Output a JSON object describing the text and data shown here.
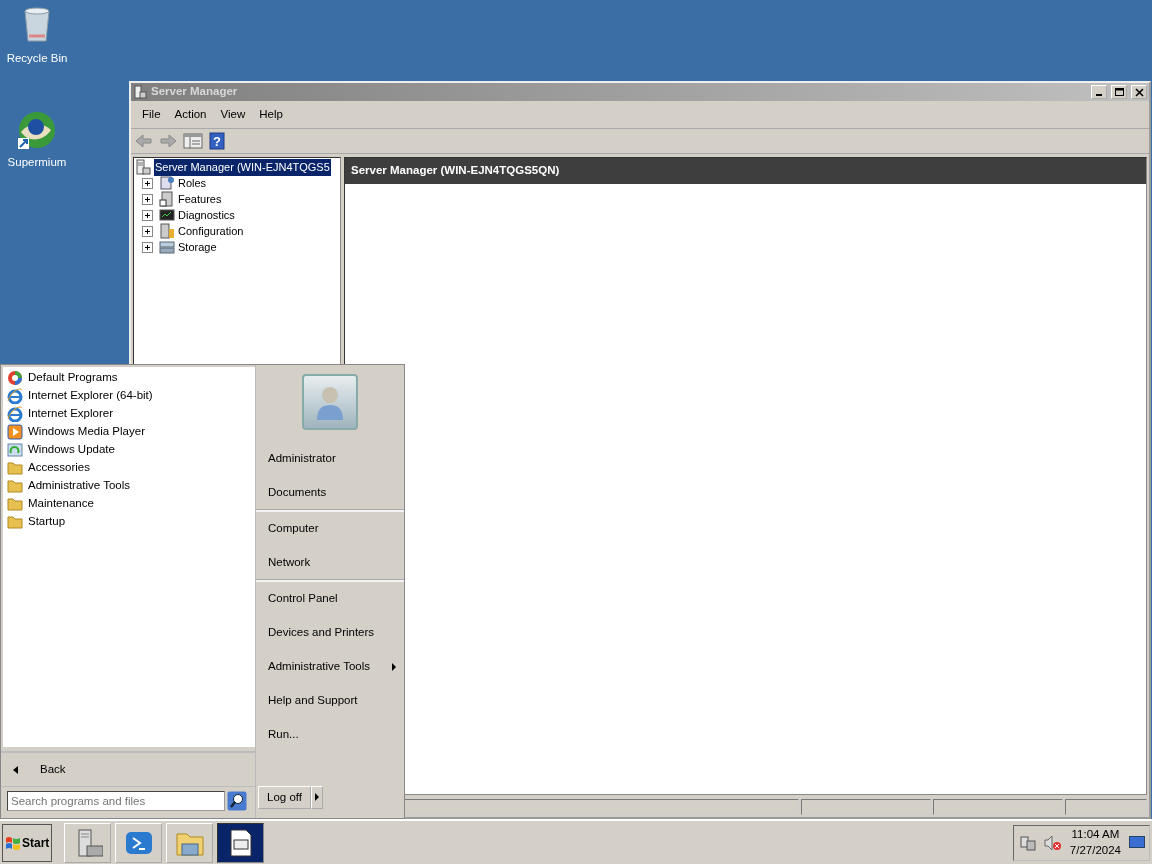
{
  "desktop_icons": [
    {
      "label": "Recycle Bin"
    },
    {
      "label": "Supermium"
    }
  ],
  "window": {
    "title": "Server Manager",
    "menu": [
      "File",
      "Action",
      "View",
      "Help"
    ],
    "help_glyph": "?",
    "tree": {
      "label": "Server Manager (WIN-EJN4TQGS5",
      "selected": true,
      "children": [
        {
          "label": "Roles",
          "expanded": false
        },
        {
          "label": "Features",
          "expanded": false
        },
        {
          "label": "Diagnostics",
          "expanded": false
        },
        {
          "label": "Configuration",
          "expanded": false
        },
        {
          "label": "Storage",
          "expanded": false
        }
      ]
    },
    "detail_header": "Server Manager (WIN-EJN4TQGS5QN)"
  },
  "start_menu": {
    "programs": [
      {
        "label": "Default Programs",
        "kind": "app"
      },
      {
        "label": "Internet Explorer (64-bit)",
        "kind": "app"
      },
      {
        "label": "Internet Explorer",
        "kind": "app"
      },
      {
        "label": "Windows Media Player",
        "kind": "app"
      },
      {
        "label": "Windows Update",
        "kind": "app"
      },
      {
        "label": "Accessories",
        "kind": "folder"
      },
      {
        "label": "Administrative Tools",
        "kind": "folder"
      },
      {
        "label": "Maintenance",
        "kind": "folder"
      },
      {
        "label": "Startup",
        "kind": "folder"
      }
    ],
    "back": "Back",
    "search": {
      "placeholder": "Search programs and files"
    },
    "right_groups": [
      {
        "items": [
          {
            "label": "Administrator",
            "submenu": false
          },
          {
            "label": "Documents",
            "submenu": false
          }
        ]
      },
      {
        "items": [
          {
            "label": "Computer",
            "submenu": false
          },
          {
            "label": "Network",
            "submenu": false
          }
        ]
      },
      {
        "items": [
          {
            "label": "Control Panel",
            "submenu": false
          },
          {
            "label": "Devices and Printers",
            "submenu": false
          },
          {
            "label": "Administrative Tools",
            "submenu": true
          },
          {
            "label": "Help and Support",
            "submenu": false
          },
          {
            "label": "Run...",
            "submenu": false
          }
        ]
      }
    ],
    "log_off": "Log off"
  },
  "taskbar": {
    "start": "Start",
    "buttons": [
      {
        "selected": false
      },
      {
        "selected": false
      },
      {
        "selected": false
      },
      {
        "selected": true
      }
    ],
    "time": "11:04 AM",
    "date": "7/27/2024"
  }
}
